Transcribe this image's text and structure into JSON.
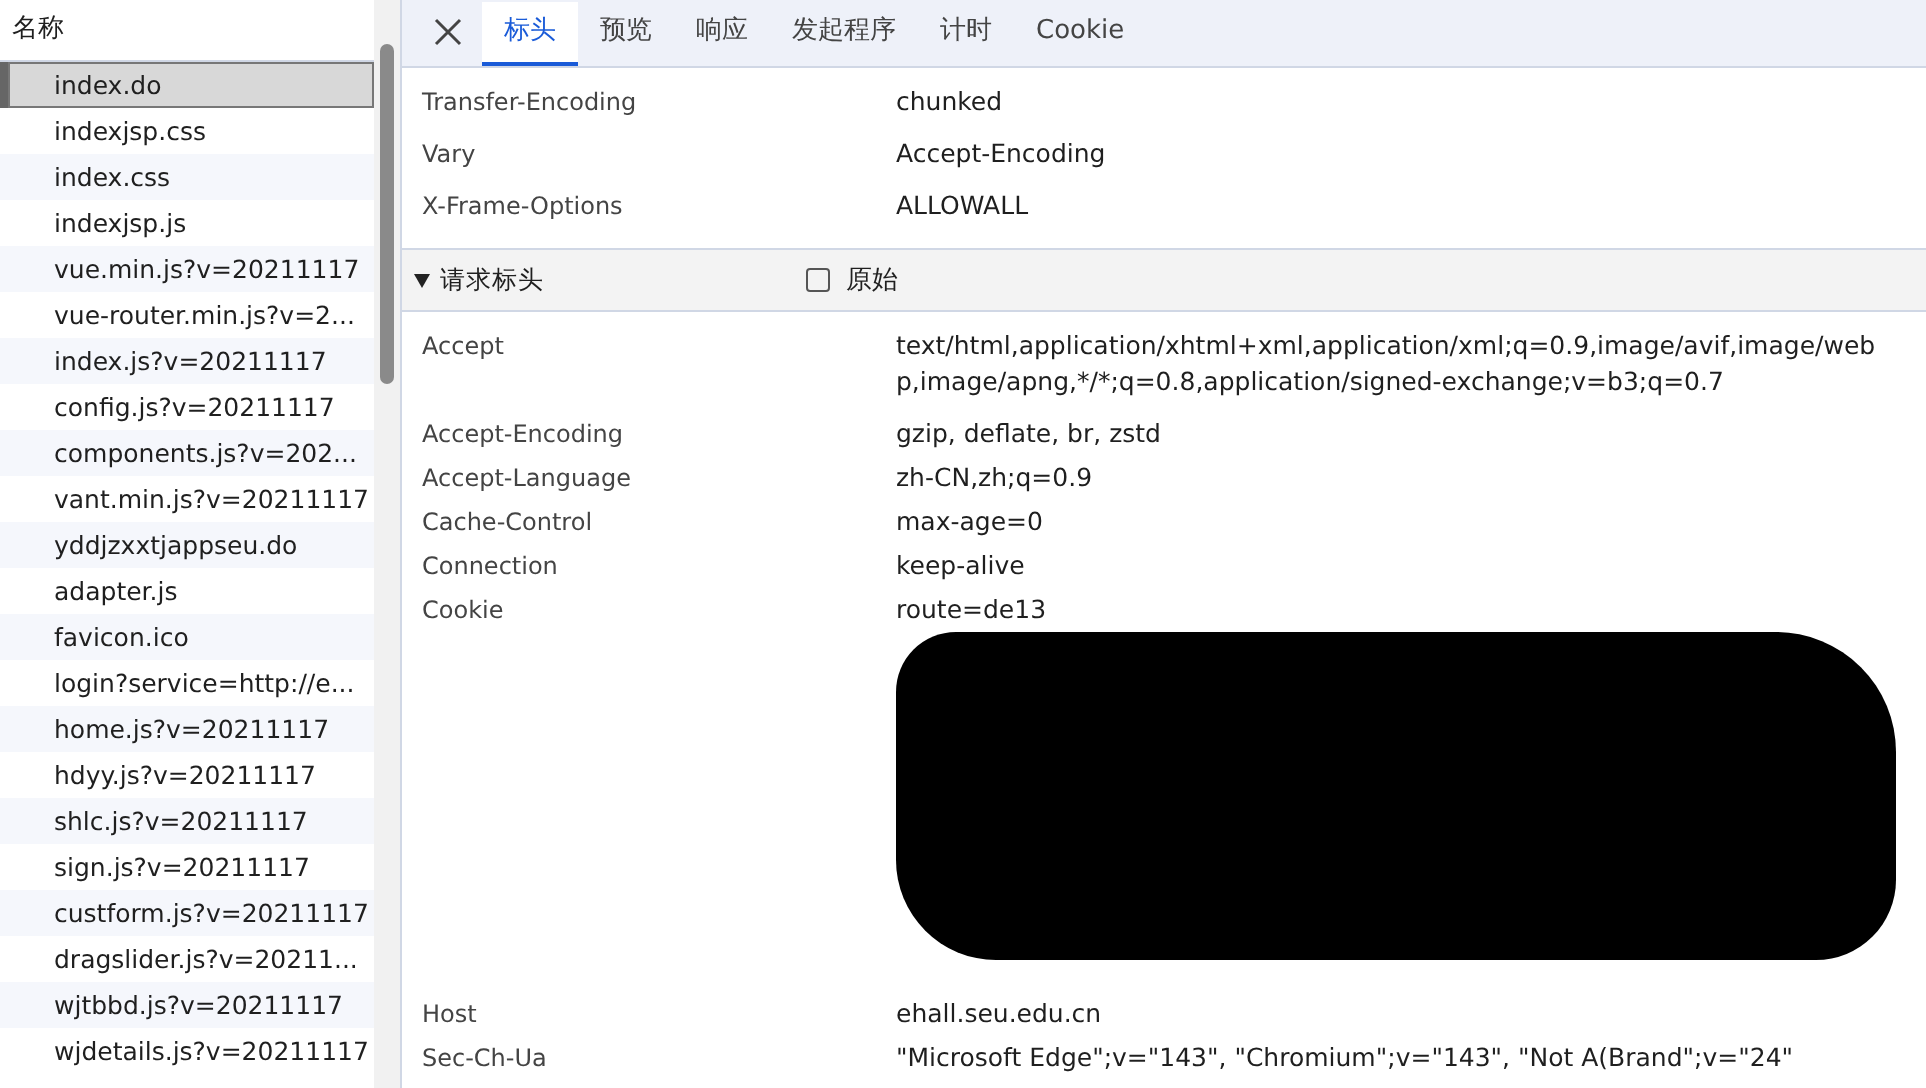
{
  "requests": {
    "header": "名称",
    "items": [
      {
        "name": "index.do",
        "selected": true
      },
      {
        "name": "indexjsp.css",
        "selected": false
      },
      {
        "name": "index.css",
        "selected": false
      },
      {
        "name": "indexjsp.js",
        "selected": false
      },
      {
        "name": "vue.min.js?v=20211117",
        "selected": false
      },
      {
        "name": "vue-router.min.js?v=2...",
        "selected": false
      },
      {
        "name": "index.js?v=20211117",
        "selected": false
      },
      {
        "name": "config.js?v=20211117",
        "selected": false
      },
      {
        "name": "components.js?v=202...",
        "selected": false
      },
      {
        "name": "vant.min.js?v=20211117",
        "selected": false
      },
      {
        "name": "yddjzxxtjappseu.do",
        "selected": false
      },
      {
        "name": "adapter.js",
        "selected": false
      },
      {
        "name": "favicon.ico",
        "selected": false
      },
      {
        "name": "login?service=http://e...",
        "selected": false
      },
      {
        "name": "home.js?v=20211117",
        "selected": false
      },
      {
        "name": "hdyy.js?v=20211117",
        "selected": false
      },
      {
        "name": "shlc.js?v=20211117",
        "selected": false
      },
      {
        "name": "sign.js?v=20211117",
        "selected": false
      },
      {
        "name": "custform.js?v=20211117",
        "selected": false
      },
      {
        "name": "dragslider.js?v=20211...",
        "selected": false
      },
      {
        "name": "wjtbbd.js?v=20211117",
        "selected": false
      },
      {
        "name": "wjdetails.js?v=20211117",
        "selected": false
      }
    ]
  },
  "tabs": [
    {
      "label": "标头",
      "selected": true
    },
    {
      "label": "预览",
      "selected": false
    },
    {
      "label": "响应",
      "selected": false
    },
    {
      "label": "发起程序",
      "selected": false
    },
    {
      "label": "计时",
      "selected": false
    },
    {
      "label": "Cookie",
      "selected": false
    }
  ],
  "response_headers": [
    {
      "name": "Transfer-Encoding",
      "value": "chunked"
    },
    {
      "name": "Vary",
      "value": "Accept-Encoding"
    },
    {
      "name": "X-Frame-Options",
      "value": "ALLOWALL"
    }
  ],
  "request_section": {
    "title": "请求标头",
    "expanded": true,
    "raw": {
      "label": "原始",
      "checked": false
    }
  },
  "request_headers": [
    {
      "name": "Accept",
      "value": "text/html,application/xhtml+xml,application/xml;q=0.9,image/avif,image/webp,image/apng,*/*;q=0.8,application/signed-exchange;v=b3;q=0.7"
    },
    {
      "name": "Accept-Encoding",
      "value": "gzip, deflate, br, zstd"
    },
    {
      "name": "Accept-Language",
      "value": "zh-CN,zh;q=0.9"
    },
    {
      "name": "Cache-Control",
      "value": "max-age=0"
    },
    {
      "name": "Connection",
      "value": "keep-alive"
    },
    {
      "name": "Cookie",
      "value": "route=de13",
      "redacted": true
    },
    {
      "name": "Host",
      "value": "ehall.seu.edu.cn"
    },
    {
      "name": "Sec-Ch-Ua",
      "value": "\"Microsoft Edge\";v=\"143\", \"Chromium\";v=\"143\", \"Not A(Brand\";v=\"24\""
    }
  ]
}
